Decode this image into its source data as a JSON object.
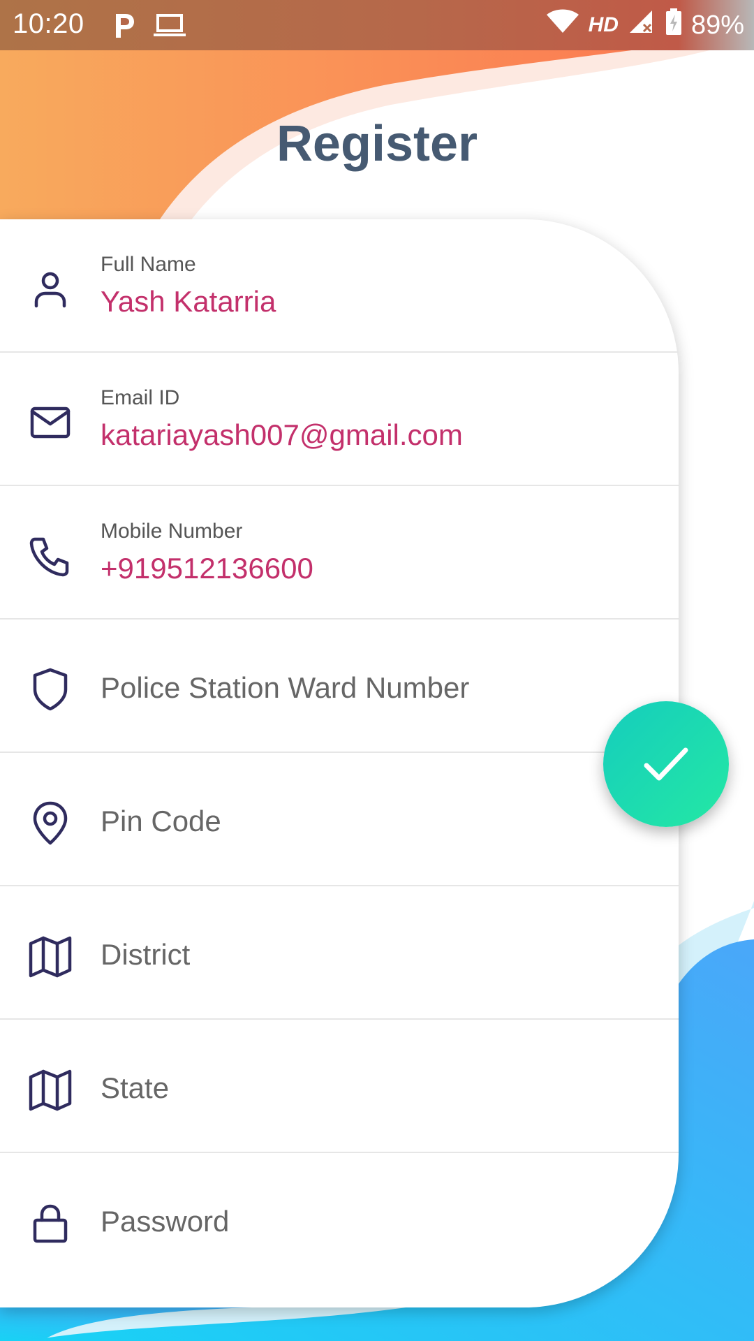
{
  "status_bar": {
    "time": "10:20",
    "network": "HD",
    "battery": "89%"
  },
  "page": {
    "title": "Register"
  },
  "fields": [
    {
      "label": "Full Name",
      "value": "Yash Katarria",
      "icon": "person-icon"
    },
    {
      "label": "Email ID",
      "value": "katariayash007@gmail.com",
      "icon": "mail-icon"
    },
    {
      "label": "Mobile Number",
      "value": "+919512136600",
      "icon": "phone-icon"
    },
    {
      "placeholder": "Police Station Ward Number",
      "icon": "shield-icon"
    },
    {
      "placeholder": "Pin Code",
      "icon": "map-pin-icon"
    },
    {
      "placeholder": "District",
      "icon": "map-icon"
    },
    {
      "placeholder": "State",
      "icon": "map-icon"
    },
    {
      "placeholder": "Password",
      "icon": "lock-icon"
    }
  ],
  "colors": {
    "title": "#465a72",
    "value_text": "#c3306b",
    "icon_stroke": "#2f2b5e",
    "fab_start": "#15cdbd",
    "fab_end": "#24e8a4",
    "top_wave_start": "#f8a95c",
    "top_wave_end": "#fb7650",
    "bottom_wave": "#3fb0f8"
  },
  "fab": {
    "icon": "check-icon"
  }
}
